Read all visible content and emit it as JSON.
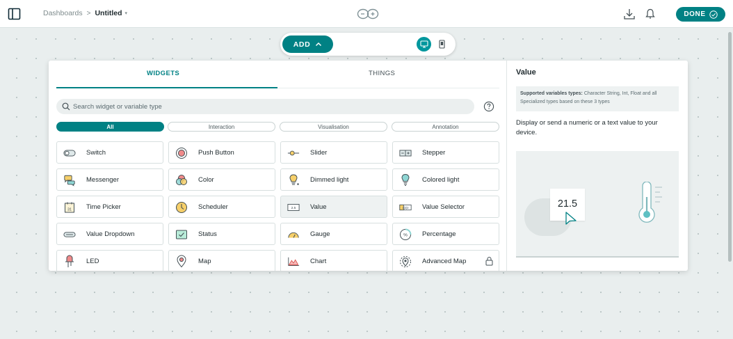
{
  "header": {
    "breadcrumb_root": "Dashboards",
    "breadcrumb_separator": ">",
    "dashboard_name": "Untitled",
    "name_caret": "▾",
    "done_label": "DONE"
  },
  "add_bar": {
    "add_label": "ADD",
    "add_caret": "^",
    "active_view": "desktop"
  },
  "panel": {
    "tabs": [
      {
        "label": "WIDGETS",
        "active": true
      },
      {
        "label": "THINGS",
        "active": false
      }
    ],
    "search": {
      "placeholder": "Search widget or variable type",
      "value": ""
    },
    "filters": [
      {
        "label": "All",
        "active": true
      },
      {
        "label": "Interaction",
        "active": false
      },
      {
        "label": "Visualisation",
        "active": false
      },
      {
        "label": "Annotation",
        "active": false
      }
    ],
    "widgets": [
      {
        "label": "Switch",
        "icon": "switch-icon"
      },
      {
        "label": "Push Button",
        "icon": "push-button-icon"
      },
      {
        "label": "Slider",
        "icon": "slider-icon"
      },
      {
        "label": "Stepper",
        "icon": "stepper-icon"
      },
      {
        "label": "Messenger",
        "icon": "messenger-icon"
      },
      {
        "label": "Color",
        "icon": "color-icon"
      },
      {
        "label": "Dimmed light",
        "icon": "dimmed-light-icon"
      },
      {
        "label": "Colored light",
        "icon": "colored-light-icon"
      },
      {
        "label": "Time Picker",
        "icon": "time-picker-icon",
        "icon_text": "31"
      },
      {
        "label": "Scheduler",
        "icon": "scheduler-icon"
      },
      {
        "label": "Value",
        "icon": "value-icon",
        "icon_text": "2.5",
        "selected": true
      },
      {
        "label": "Value Selector",
        "icon": "value-selector-icon",
        "icon_text": "1|2|3"
      },
      {
        "label": "Value Dropdown",
        "icon": "value-dropdown-icon"
      },
      {
        "label": "Status",
        "icon": "status-icon"
      },
      {
        "label": "Gauge",
        "icon": "gauge-icon"
      },
      {
        "label": "Percentage",
        "icon": "percentage-icon",
        "icon_text": "%"
      },
      {
        "label": "LED",
        "icon": "led-icon"
      },
      {
        "label": "Map",
        "icon": "map-icon"
      },
      {
        "label": "Chart",
        "icon": "chart-icon"
      },
      {
        "label": "Advanced Map",
        "icon": "advanced-map-icon",
        "locked": true
      }
    ]
  },
  "detail": {
    "title": "Value",
    "supported_label": "Supported variables types:",
    "supported_types": "Character String, Int, Float and all Specialized types based on these 3 types",
    "description": "Display or send a numeric or a text value to your device.",
    "preview_value": "21.5"
  },
  "colors": {
    "accent": "#008184",
    "canvas": "#e9eeee",
    "text": "#1f2a2e"
  }
}
